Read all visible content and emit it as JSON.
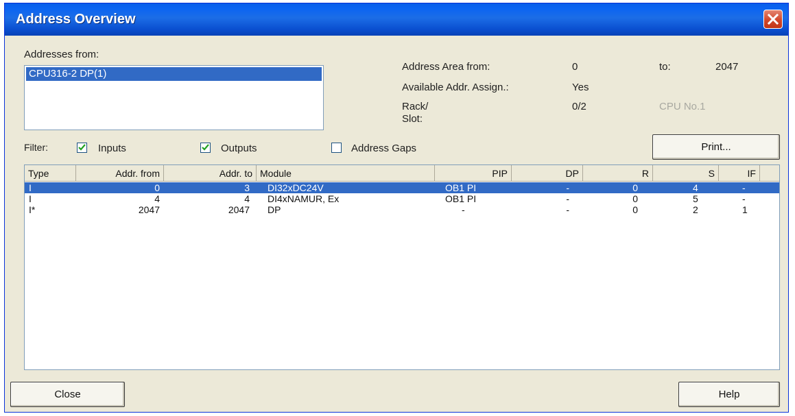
{
  "window": {
    "title": "Address Overview"
  },
  "addresses": {
    "label": "Addresses from:",
    "items": [
      "CPU316-2 DP(1)"
    ]
  },
  "info": {
    "area_from_label": "Address Area from:",
    "area_from_value": "0",
    "to_label": "to:",
    "to_value": "2047",
    "avail_label": "Available Addr. Assign.:",
    "avail_value": "Yes",
    "rack_label_1": "Rack/",
    "rack_label_2": "Slot:",
    "rack_value": "0/2",
    "cpu_no": "CPU No.1"
  },
  "filter": {
    "label": "Filter:",
    "inputs": {
      "label": "Inputs",
      "checked": true
    },
    "outputs": {
      "label": "Outputs",
      "checked": true
    },
    "gaps": {
      "label": "Address Gaps",
      "checked": false
    }
  },
  "buttons": {
    "print": "Print...",
    "close": "Close",
    "help": "Help"
  },
  "table": {
    "columns": [
      "Type",
      "Addr. from",
      "Addr. to",
      "Module",
      "PIP",
      "DP",
      "R",
      "S",
      "IF"
    ],
    "rows": [
      [
        "I",
        "0",
        "3",
        "DI32xDC24V",
        "OB1 PI",
        "-",
        "0",
        "4",
        "-"
      ],
      [
        "I",
        "4",
        "4",
        "DI4xNAMUR, Ex",
        "OB1 PI",
        "-",
        "0",
        "5",
        "-"
      ],
      [
        "I*",
        "2047",
        "2047",
        "DP",
        "-",
        "-",
        "0",
        "2",
        "1"
      ]
    ],
    "selected_row": 0
  },
  "colors": {
    "selection": "#316ac5",
    "titlebar": "#0a5ee8",
    "dialog": "#ece9d8"
  }
}
